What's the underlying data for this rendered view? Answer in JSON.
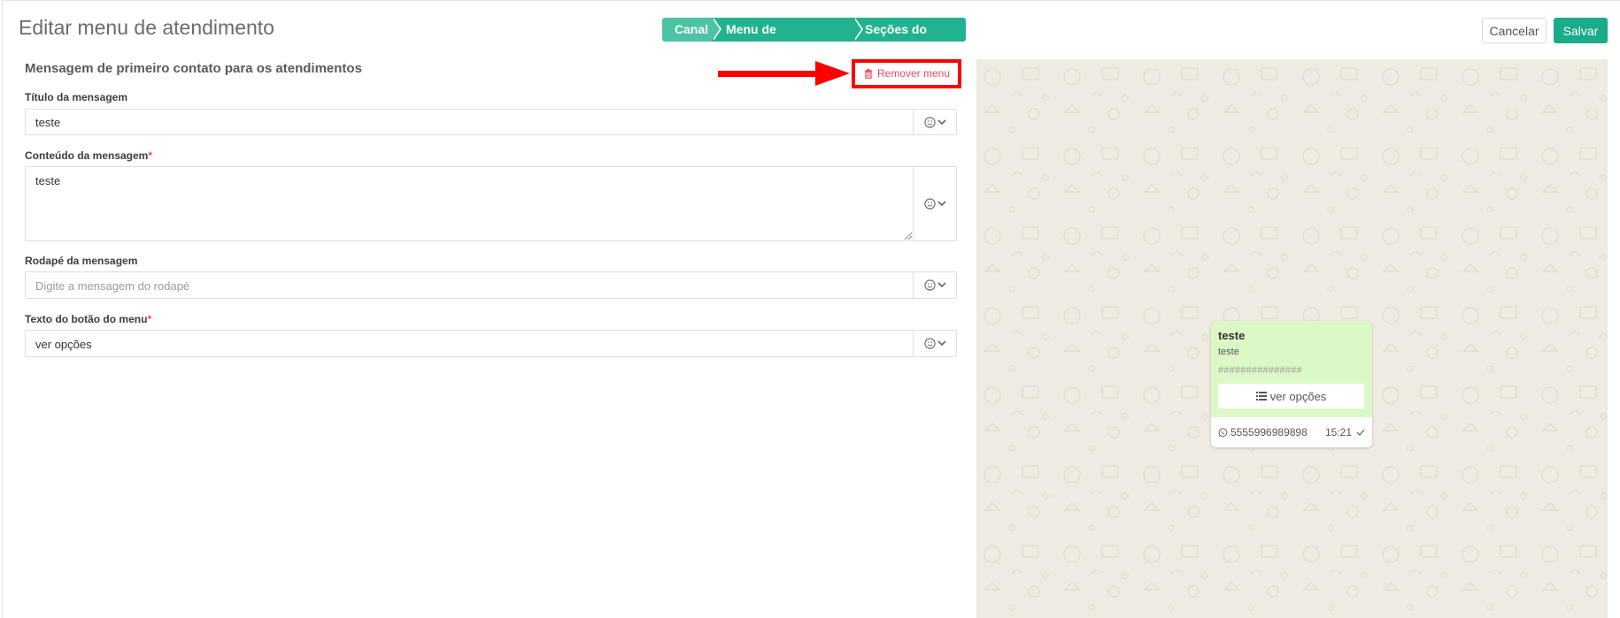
{
  "header": {
    "title": "Editar menu de atendimento",
    "steps": [
      "Canal",
      "Menu de atendimento",
      "Seções do menu"
    ],
    "cancel_label": "Cancelar",
    "save_label": "Salvar"
  },
  "form": {
    "section_title": "Mensagem de primeiro contato para os atendimentos",
    "remove_label": "Remover menu",
    "title_label": "Título da mensagem",
    "title_value": "teste",
    "content_label": "Conteúdo da mensagem",
    "content_value": "teste",
    "footer_label": "Rodapé da mensagem",
    "footer_placeholder": "Digite a mensagem do rodapé",
    "button_label": "Texto do botão do menu",
    "button_value": "ver opções",
    "required_mark": "*"
  },
  "preview": {
    "title": "teste",
    "body": "teste",
    "footer": "###############",
    "button_label": "ver opções",
    "phone": "5555996989898",
    "time": "15:21"
  },
  "colors": {
    "accent": "#1aab8a",
    "step_active": "#21b38f",
    "step_done": "#4cc3a4",
    "danger": "#e84b5e",
    "annotation": "#ff0000",
    "bubble": "#dcf8c6"
  }
}
